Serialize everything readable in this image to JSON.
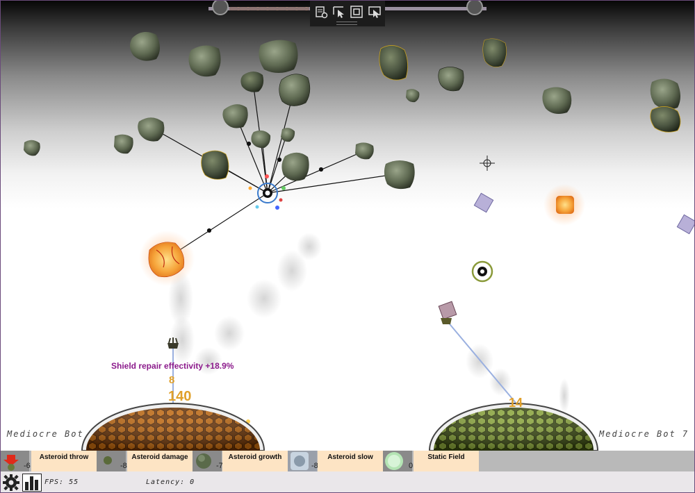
{
  "players": {
    "left_label": "Mediocre Bot",
    "right_label": "Mediocre Bot 7"
  },
  "hud": {
    "effect_text": "Shield repair effectivity +18.9%",
    "left_small_count": "8",
    "left_score": "140",
    "right_score": "14"
  },
  "abilities": [
    {
      "name": "Asteroid throw",
      "count": "-6",
      "icon": "asteroid-throw-icon"
    },
    {
      "name": "Asteroid damage",
      "count": "-8",
      "icon": "asteroid-damage-icon"
    },
    {
      "name": "Asteroid growth",
      "count": "-7",
      "icon": "asteroid-growth-icon"
    },
    {
      "name": "Asteroid slow",
      "count": "-8",
      "icon": "asteroid-slow-icon"
    },
    {
      "name": "Static Field",
      "count": "0",
      "icon": "static-field-icon"
    }
  ],
  "status": {
    "fps": "FPS: 55",
    "latency": "Latency: 0"
  },
  "toolbar": {
    "icons": [
      "settings-list-icon",
      "select-pointer-icon",
      "frame-icon",
      "screen-select-icon"
    ]
  },
  "colors": {
    "effect_text": "#8b1a8b",
    "score": "#e0a02a",
    "left_dome": "#b05a10",
    "right_dome": "#7a9a2a",
    "ability_label_bg": "#fde4c4"
  }
}
